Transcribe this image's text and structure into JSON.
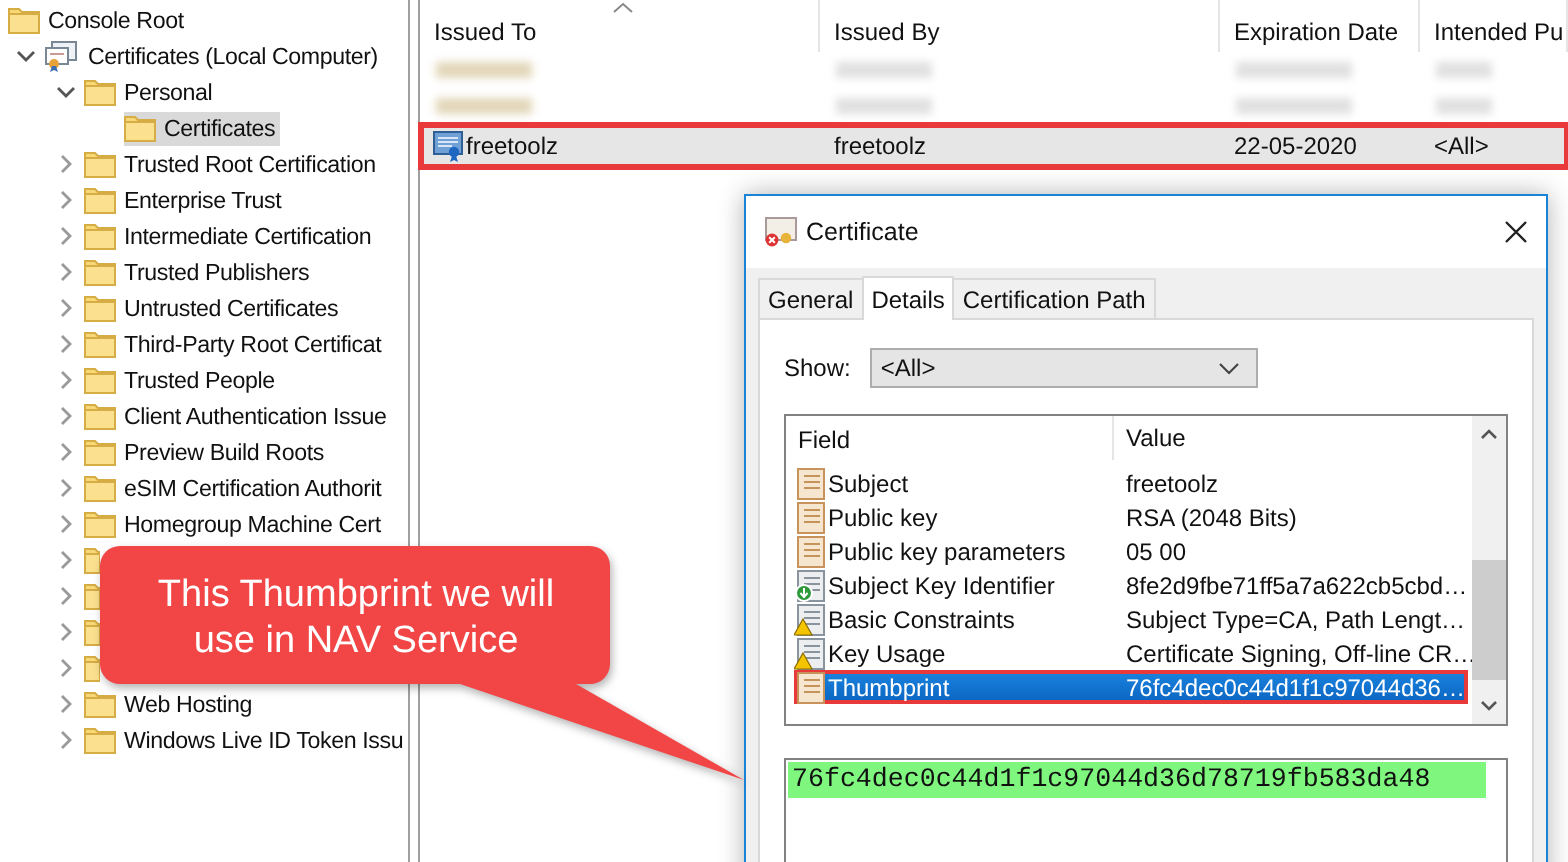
{
  "tree": {
    "items": [
      {
        "label": "Console Root",
        "kind": "folder",
        "selected": false,
        "children": [
          {
            "label": "Certificates (Local Computer)",
            "kind": "store",
            "expanded": true,
            "selected": false,
            "children": [
              {
                "label": "Personal",
                "kind": "folder",
                "expanded": true,
                "selected": false,
                "children": [
                  {
                    "label": "Certificates",
                    "kind": "folder",
                    "selected": true
                  }
                ]
              },
              {
                "label": "Trusted Root Certification",
                "kind": "folder",
                "expanded": false,
                "selected": false
              },
              {
                "label": "Enterprise Trust",
                "kind": "folder",
                "expanded": false,
                "selected": false
              },
              {
                "label": "Intermediate Certification",
                "kind": "folder",
                "expanded": false,
                "selected": false
              },
              {
                "label": "Trusted Publishers",
                "kind": "folder",
                "expanded": false,
                "selected": false
              },
              {
                "label": "Untrusted Certificates",
                "kind": "folder",
                "expanded": false,
                "selected": false
              },
              {
                "label": "Third-Party Root Certificat",
                "kind": "folder",
                "expanded": false,
                "selected": false
              },
              {
                "label": "Trusted People",
                "kind": "folder",
                "expanded": false,
                "selected": false
              },
              {
                "label": "Client Authentication Issue",
                "kind": "folder",
                "expanded": false,
                "selected": false
              },
              {
                "label": "Preview Build Roots",
                "kind": "folder",
                "expanded": false,
                "selected": false
              },
              {
                "label": "eSIM Certification Authorit",
                "kind": "folder",
                "expanded": false,
                "selected": false
              },
              {
                "label": "Homegroup Machine Cert",
                "kind": "folder",
                "expanded": false,
                "selected": false
              },
              {
                "kind": "folder",
                "expanded": false,
                "selected": false
              },
              {
                "kind": "folder",
                "expanded": false,
                "selected": false
              },
              {
                "kind": "folder",
                "expanded": false,
                "selected": false
              },
              {
                "kind": "folder",
                "expanded": false,
                "selected": false
              },
              {
                "label": "Web Hosting",
                "kind": "folder",
                "expanded": false,
                "selected": false
              },
              {
                "label": "Windows Live ID Token Issu",
                "kind": "folder",
                "expanded": false,
                "selected": false
              }
            ]
          }
        ]
      }
    ]
  },
  "list": {
    "columns": [
      "Issued To",
      "Issued By",
      "Expiration Date",
      "Intended Pu"
    ],
    "rows": [
      {
        "kind": "blurred",
        "selected": false,
        "outlined": false
      },
      {
        "kind": "blurred",
        "selected": false,
        "outlined": false
      },
      {
        "kind": "certificate",
        "selected": true,
        "outlined": true,
        "cells": [
          "freetoolz",
          "freetoolz",
          "22-05-2020",
          "<All>"
        ]
      }
    ]
  },
  "dialog": {
    "title": "Certificate",
    "tabs": [
      {
        "label": "General",
        "selected": false
      },
      {
        "label": "Details",
        "selected": true
      },
      {
        "label": "Certification Path",
        "selected": false
      }
    ],
    "show_label": "Show:",
    "show_value": "<All>",
    "columns": [
      "Field",
      "Value"
    ],
    "fields": [
      {
        "kind": "property",
        "field": "Subject",
        "value": "freetoolz",
        "selected": false,
        "outlined": false
      },
      {
        "kind": "property",
        "field": "Public key",
        "value": "RSA (2048 Bits)",
        "selected": false,
        "outlined": false
      },
      {
        "kind": "property",
        "field": "Public key parameters",
        "value": "05 00",
        "selected": false,
        "outlined": false
      },
      {
        "kind": "extension",
        "field": "Subject Key Identifier",
        "value": "8fe2d9fbe71ff5a7a622cb5cbd…",
        "selected": false,
        "outlined": false
      },
      {
        "kind": "critical",
        "field": "Basic Constraints",
        "value": "Subject Type=CA, Path Lengt…",
        "selected": false,
        "outlined": false
      },
      {
        "kind": "critical",
        "field": "Key Usage",
        "value": "Certificate Signing, Off-line CR…",
        "selected": false,
        "outlined": false
      },
      {
        "kind": "property",
        "field": "Thumbprint",
        "value": "76fc4dec0c44d1f1c97044d36…",
        "selected": true,
        "outlined": true
      }
    ],
    "detail_value": "76fc4dec0c44d1f1c97044d36d78719fb583da48",
    "detail_highlighted": true
  },
  "callout": {
    "text": "This Thumbprint we will use in NAV Service"
  }
}
